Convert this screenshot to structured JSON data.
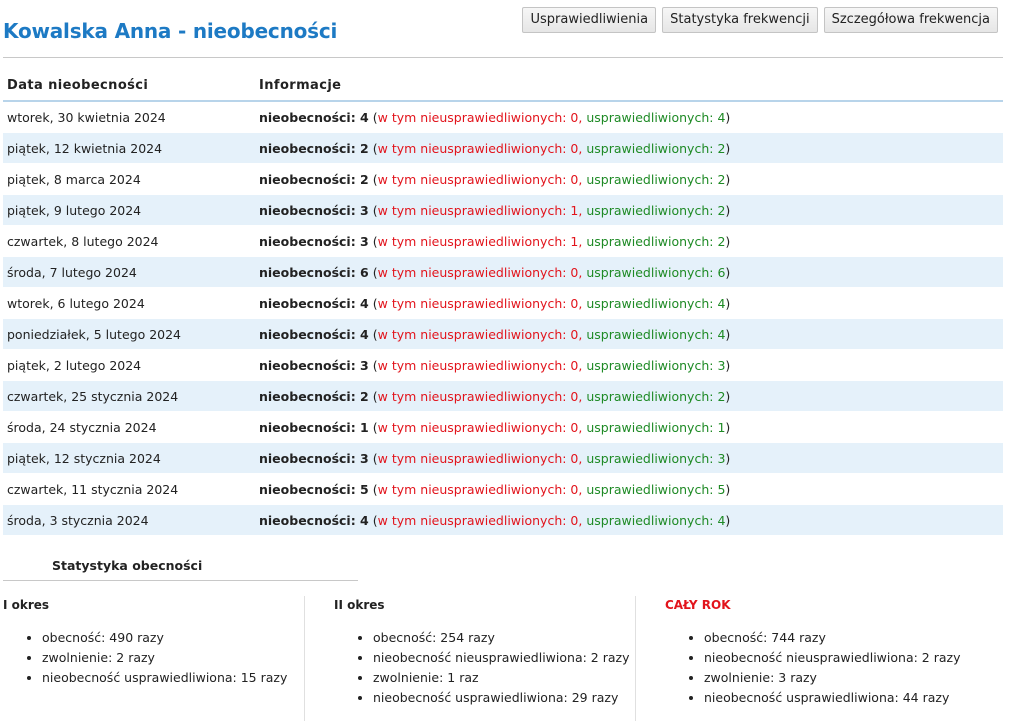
{
  "page": {
    "title": "Kowalska Anna - nieobecności"
  },
  "toolbar": {
    "buttons": [
      {
        "label": "Usprawiedliwienia"
      },
      {
        "label": "Statystyka frekwencji"
      },
      {
        "label": "Szczegółowa frekwencja"
      }
    ]
  },
  "table": {
    "headers": {
      "date": "Data nieobecności",
      "info": "Informacje"
    },
    "rows": [
      {
        "date": "wtorek, 30 kwietnia 2024",
        "label": "nieobecności: 4",
        "open": " (",
        "unjust": "w tym nieusprawiedliwionych: 0,",
        "just": "usprawiedliwionych: 4",
        "close": ")"
      },
      {
        "date": "piątek, 12 kwietnia 2024",
        "label": "nieobecności: 2",
        "open": " (",
        "unjust": "w tym nieusprawiedliwionych: 0,",
        "just": "usprawiedliwionych: 2",
        "close": ")"
      },
      {
        "date": "piątek, 8 marca 2024",
        "label": "nieobecności: 2",
        "open": " (",
        "unjust": "w tym nieusprawiedliwionych: 0,",
        "just": "usprawiedliwionych: 2",
        "close": ")"
      },
      {
        "date": "piątek, 9 lutego 2024",
        "label": "nieobecności: 3",
        "open": " (",
        "unjust": "w tym nieusprawiedliwionych: 1,",
        "just": "usprawiedliwionych: 2",
        "close": ")"
      },
      {
        "date": "czwartek, 8 lutego 2024",
        "label": "nieobecności: 3",
        "open": " (",
        "unjust": "w tym nieusprawiedliwionych: 1,",
        "just": "usprawiedliwionych: 2",
        "close": ")"
      },
      {
        "date": "środa, 7 lutego 2024",
        "label": "nieobecności: 6",
        "open": " (",
        "unjust": "w tym nieusprawiedliwionych: 0,",
        "just": "usprawiedliwionych: 6",
        "close": ")"
      },
      {
        "date": "wtorek, 6 lutego 2024",
        "label": "nieobecności: 4",
        "open": " (",
        "unjust": "w tym nieusprawiedliwionych: 0,",
        "just": "usprawiedliwionych: 4",
        "close": ")"
      },
      {
        "date": "poniedziałek, 5 lutego 2024",
        "label": "nieobecności: 4",
        "open": " (",
        "unjust": "w tym nieusprawiedliwionych: 0,",
        "just": "usprawiedliwionych: 4",
        "close": ")"
      },
      {
        "date": "piątek, 2 lutego 2024",
        "label": "nieobecności: 3",
        "open": " (",
        "unjust": "w tym nieusprawiedliwionych: 0,",
        "just": "usprawiedliwionych: 3",
        "close": ")"
      },
      {
        "date": "czwartek, 25 stycznia 2024",
        "label": "nieobecności: 2",
        "open": " (",
        "unjust": "w tym nieusprawiedliwionych: 0,",
        "just": "usprawiedliwionych: 2",
        "close": ")"
      },
      {
        "date": "środa, 24 stycznia 2024",
        "label": "nieobecności: 1",
        "open": " (",
        "unjust": "w tym nieusprawiedliwionych: 0,",
        "just": "usprawiedliwionych: 1",
        "close": ")"
      },
      {
        "date": "piątek, 12 stycznia 2024",
        "label": "nieobecności: 3",
        "open": " (",
        "unjust": "w tym nieusprawiedliwionych: 0,",
        "just": "usprawiedliwionych: 3",
        "close": ")"
      },
      {
        "date": "czwartek, 11 stycznia 2024",
        "label": "nieobecności: 5",
        "open": " (",
        "unjust": "w tym nieusprawiedliwionych: 0,",
        "just": "usprawiedliwionych: 5",
        "close": ")"
      },
      {
        "date": "środa, 3 stycznia 2024",
        "label": "nieobecności: 4",
        "open": " (",
        "unjust": "w tym nieusprawiedliwionych: 0,",
        "just": "usprawiedliwionych: 4",
        "close": ")"
      }
    ]
  },
  "stats": {
    "title": "Statystyka obecności",
    "columns": [
      {
        "heading": "I okres",
        "items": [
          "obecność: 490 razy",
          "zwolnienie: 2 razy",
          "nieobecność usprawiedliwiona: 15 razy"
        ]
      },
      {
        "heading": "II okres",
        "items": [
          "obecność: 254 razy",
          "nieobecność nieusprawiedliwiona: 2 razy",
          "zwolnienie: 1 raz",
          "nieobecność usprawiedliwiona: 29 razy"
        ]
      },
      {
        "heading": "CAŁY ROK",
        "items": [
          "obecność: 744 razy",
          "nieobecność nieusprawiedliwiona: 2 razy",
          "zwolnienie: 3 razy",
          "nieobecność usprawiedliwiona: 44 razy"
        ]
      }
    ]
  },
  "colors": {
    "title": "#1d7ac4",
    "unjustified": "#e2141c",
    "justified": "#1e8a25",
    "row_alt": "#e5f1fa",
    "year_heading": "#e2141c"
  }
}
